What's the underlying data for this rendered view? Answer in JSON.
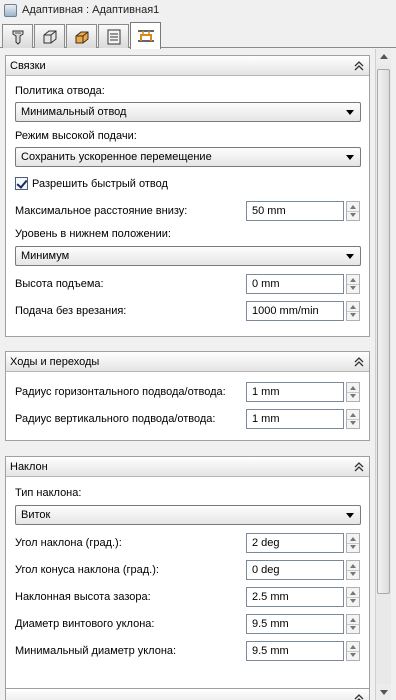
{
  "window": {
    "title": "Адаптивная : Адаптивная1"
  },
  "tabs": [
    {
      "icon": "tool-icon"
    },
    {
      "icon": "geometry-icon"
    },
    {
      "icon": "heights-icon"
    },
    {
      "icon": "passes-icon"
    },
    {
      "icon": "linking-icon",
      "active": true
    }
  ],
  "links_panel": {
    "title": "Связки",
    "retract_policy_label": "Политика отвода:",
    "retract_policy_value": "Минимальный отвод",
    "high_feed_mode_label": "Режим высокой подачи:",
    "high_feed_mode_value": "Сохранить ускоренное перемещение",
    "fast_retract_label": "Разрешить быстрый отвод",
    "fast_retract_checked": true,
    "max_stay_down_label": "Максимальное расстояние внизу:",
    "max_stay_down_value": "50 mm",
    "bottom_level_label": "Уровень в нижнем положении:",
    "bottom_level_value": "Минимум",
    "lift_height_label": "Высота подъема:",
    "lift_height_value": "0 mm",
    "plunge_feed_label": "Подача без врезания:",
    "plunge_feed_value": "1000 mm/min"
  },
  "leads_panel": {
    "title": "Ходы и переходы",
    "horizontal_radius_label": "Радиус горизонтального подвода/отвода:",
    "horizontal_radius_value": "1 mm",
    "vertical_radius_label": "Радиус вертикального подвода/отвода:",
    "vertical_radius_value": "1 mm"
  },
  "ramp_panel": {
    "title": "Наклон",
    "ramp_type_label": "Тип наклона:",
    "ramp_type_value": "Виток",
    "ramp_angle_label": "Угол наклона (град.):",
    "ramp_angle_value": "2 deg",
    "taper_angle_label": "Угол конуса наклона (град.):",
    "taper_angle_value": "0 deg",
    "clearance_height_label": "Наклонная высота зазора:",
    "clearance_height_value": "2.5 mm",
    "helix_diameter_label": "Диаметр винтового уклона:",
    "helix_diameter_value": "9.5 mm",
    "min_diameter_label": "Минимальный диаметр уклона:",
    "min_diameter_value": "9.5 mm"
  },
  "colors": {
    "panel_header_bg": "#e8e8e8",
    "border": "#a0a0a0",
    "accent_active_tab": "#d98a1a"
  }
}
